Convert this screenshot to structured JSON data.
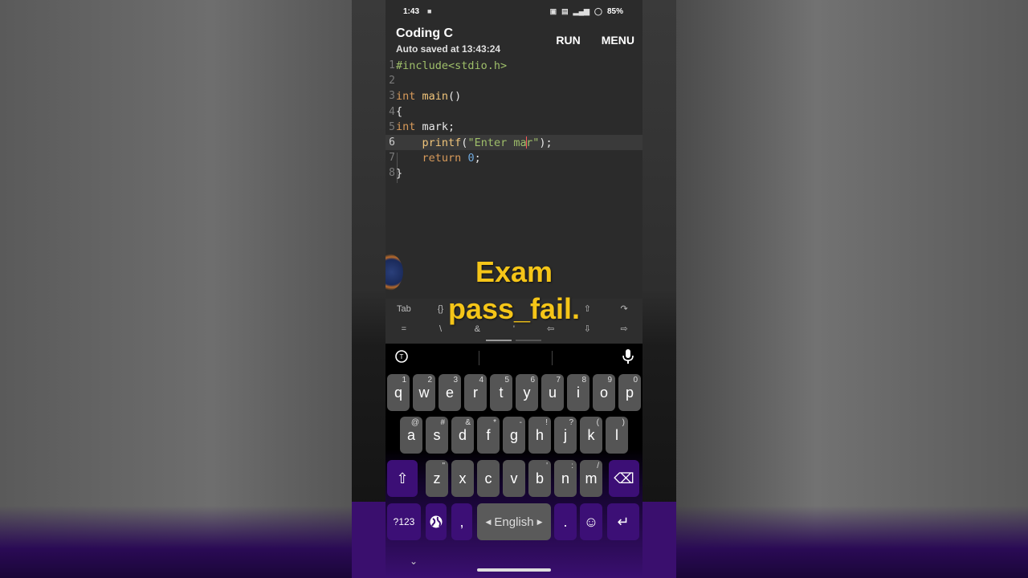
{
  "status": {
    "time": "1:43",
    "battery": "85%"
  },
  "app": {
    "title": "Coding C",
    "subtitle": "Auto saved at 13:43:24",
    "run_label": "RUN",
    "menu_label": "MENU"
  },
  "editor": {
    "line_numbers": [
      "1",
      "2",
      "3",
      "4",
      "5",
      "6",
      "7",
      "8"
    ],
    "active_line": 6
  },
  "overlay": {
    "line1": "Exam",
    "line2": "pass_fail."
  },
  "symbols": {
    "row1": [
      "Tab",
      "{}",
      "",
      "",
      "",
      "⇧",
      "↷"
    ],
    "row2": [
      "=",
      "\\",
      "&",
      "'",
      "⇦",
      "⇩",
      "⇨"
    ]
  },
  "keyboard": {
    "row1": [
      {
        "k": "q",
        "h": "1"
      },
      {
        "k": "w",
        "h": "2"
      },
      {
        "k": "e",
        "h": "3"
      },
      {
        "k": "r",
        "h": "4"
      },
      {
        "k": "t",
        "h": "5"
      },
      {
        "k": "y",
        "h": "6"
      },
      {
        "k": "u",
        "h": "7"
      },
      {
        "k": "i",
        "h": "8"
      },
      {
        "k": "o",
        "h": "9"
      },
      {
        "k": "p",
        "h": "0"
      }
    ],
    "row2": [
      {
        "k": "a",
        "h": "@"
      },
      {
        "k": "s",
        "h": "#"
      },
      {
        "k": "d",
        "h": "&"
      },
      {
        "k": "f",
        "h": "*"
      },
      {
        "k": "g",
        "h": "-"
      },
      {
        "k": "h",
        "h": "!"
      },
      {
        "k": "j",
        "h": "?"
      },
      {
        "k": "k",
        "h": "("
      },
      {
        "k": "l",
        "h": ")"
      }
    ],
    "row3": [
      {
        "k": "z",
        "h": "\""
      },
      {
        "k": "x",
        "h": ""
      },
      {
        "k": "c",
        "h": ""
      },
      {
        "k": "v",
        "h": ""
      },
      {
        "k": "b",
        "h": "'"
      },
      {
        "k": "n",
        "h": ":"
      },
      {
        "k": "m",
        "h": "/"
      }
    ],
    "numbers_key": "?123",
    "comma_key": ",",
    "space_label": "English",
    "period_key": ".",
    "emoji_key": "☺",
    "enter_key": "↵",
    "shift_key": "⇧",
    "delete_key": "⌫"
  },
  "icons": {
    "translate": "translate-icon",
    "mic": "mic-icon"
  },
  "colors": {
    "overlay_text": "#f5c518",
    "keyboard_accent": "#3c0f76",
    "editor_bg": "#2b2b2b"
  }
}
